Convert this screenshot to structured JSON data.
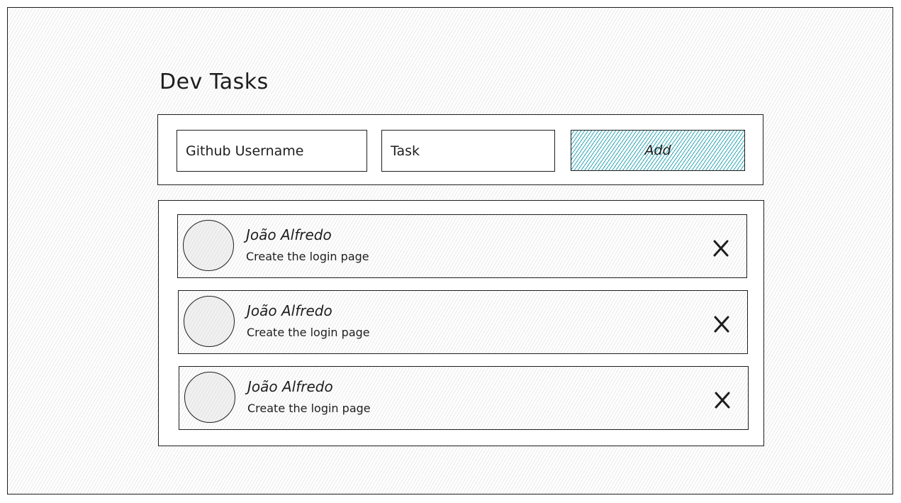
{
  "app": {
    "title": "Dev Tasks"
  },
  "form": {
    "username_placeholder": "Github Username",
    "task_placeholder": "Task",
    "add_label": "Add"
  },
  "tasks": [
    {
      "user": "João Alfredo",
      "description": "Create the login page",
      "delete_icon": "close-icon"
    },
    {
      "user": "João Alfredo",
      "description": "Create the login page",
      "delete_icon": "close-icon"
    },
    {
      "user": "João Alfredo",
      "description": "Create the login page",
      "delete_icon": "close-icon"
    }
  ],
  "colors": {
    "accent": "#2fa6b4",
    "stroke": "#1e1e1e"
  }
}
